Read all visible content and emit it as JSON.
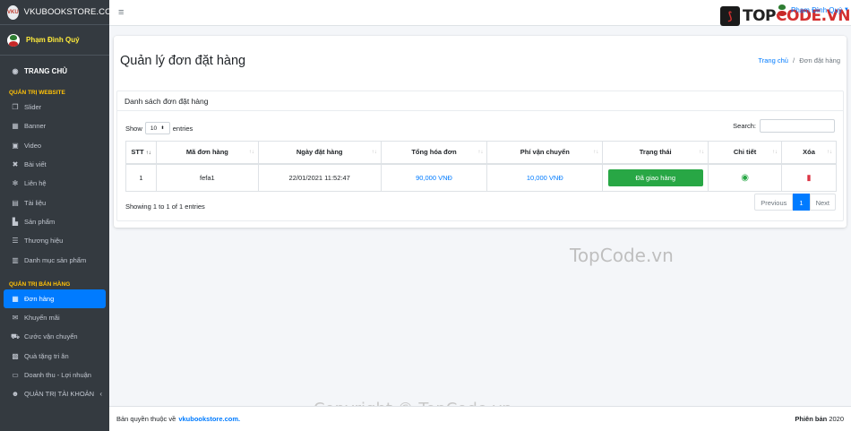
{
  "brand": {
    "logo_text": "VKU",
    "name": "VKUBOOKSTORE.COM"
  },
  "user": {
    "name": "Phạm Đình Quý"
  },
  "sidebar": {
    "home": "TRANG CHỦ",
    "section1": "QUẢN TRỊ WEBSITE",
    "website_items": [
      "Slider",
      "Banner",
      "Video",
      "Bài viết",
      "Liên hệ",
      "Tài liệu",
      "Sản phẩm",
      "Thương hiệu",
      "Danh mục sản phẩm"
    ],
    "section2": "QUẢN TRỊ BÁN HÀNG",
    "sales_items": [
      "Đơn hàng",
      "Khuyến mãi",
      "Cước vận chuyển",
      "Quà tặng tri ân",
      "Doanh thu - Lợi nhuận"
    ],
    "account": "QUẢN TRỊ TÀI KHOẢN"
  },
  "topbar": {
    "user_name": "Phạm Đình Quý",
    "logo_prefix": "TOP",
    "logo_suffix": "CODE.VN"
  },
  "page": {
    "title": "Quản lý đơn đặt hàng",
    "breadcrumb_home": "Trang chủ",
    "breadcrumb_sep": "/",
    "breadcrumb_current": "Đơn đặt hàng"
  },
  "card": {
    "header": "Danh sách đơn đặt hàng",
    "show_label": "Show",
    "show_value": "10",
    "entries_label": "entries",
    "search_label": "Search:"
  },
  "table": {
    "columns": [
      "STT",
      "Mã đơn hàng",
      "Ngày đặt hàng",
      "Tổng hóa đơn",
      "Phí vận chuyển",
      "Trạng thái",
      "Chi tiết",
      "Xóa"
    ],
    "rows": [
      {
        "stt": "1",
        "code": "fefa1",
        "date": "22/01/2021 11:52:47",
        "total": "90,000 VNĐ",
        "shipping": "10,000 VNĐ",
        "status": "Đã giao hàng"
      }
    ]
  },
  "pagination": {
    "info": "Showing 1 to 1 of 1 entries",
    "prev": "Previous",
    "page": "1",
    "next": "Next"
  },
  "watermark": {
    "center": "TopCode.vn",
    "bottom": "Copyright © TopCode.vn"
  },
  "footer": {
    "prefix": "Bản quyền thuộc về",
    "site": "vkubookstore.com.",
    "version_label": "Phiên bản",
    "version": "2020"
  }
}
